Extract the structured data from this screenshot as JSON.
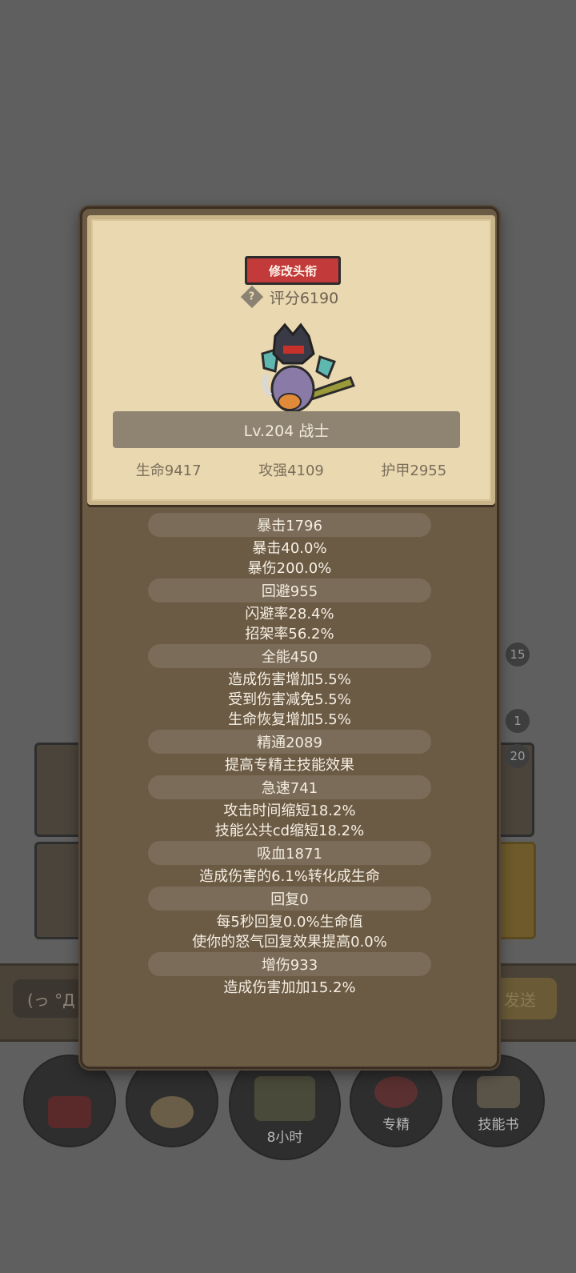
{
  "background": {
    "badges": [
      "15",
      "1",
      "20"
    ],
    "chat_placeholder": "(っ °Д °",
    "send_label": "发送",
    "bottom_nav": [
      {
        "label": ""
      },
      {
        "label": ""
      },
      {
        "label": "8小时"
      },
      {
        "label": "专精"
      },
      {
        "label": "技能书"
      }
    ]
  },
  "modal": {
    "title_button": "修改头衔",
    "score": "评分6190",
    "hero_banner": "Lv.204 战士",
    "base_stats": [
      "生命9417",
      "攻强4109",
      "护甲2955"
    ],
    "stat_groups": [
      {
        "header": "暴击1796",
        "lines": [
          "暴击40.0%",
          "暴伤200.0%"
        ]
      },
      {
        "header": "回避955",
        "lines": [
          "闪避率28.4%",
          "招架率56.2%"
        ]
      },
      {
        "header": "全能450",
        "lines": [
          "造成伤害增加5.5%",
          "受到伤害减免5.5%",
          "生命恢复增加5.5%"
        ]
      },
      {
        "header": "精通2089",
        "lines": [
          "提高专精主技能效果"
        ]
      },
      {
        "header": "急速741",
        "lines": [
          "攻击时间缩短18.2%",
          "技能公共cd缩短18.2%"
        ]
      },
      {
        "header": "吸血1871",
        "lines": [
          "造成伤害的6.1%转化成生命"
        ]
      },
      {
        "header": "回复0",
        "lines": [
          "每5秒回复0.0%生命值",
          "使你的怒气回复效果提高0.0%"
        ]
      },
      {
        "header": "增伤933",
        "lines": [
          "造成伤害加加15.2%"
        ]
      }
    ]
  },
  "colors": {
    "title_button": "#c23a3a",
    "card": "#ead8b0",
    "panel": "#6b5b45",
    "stat_header": "#7a6c58"
  }
}
